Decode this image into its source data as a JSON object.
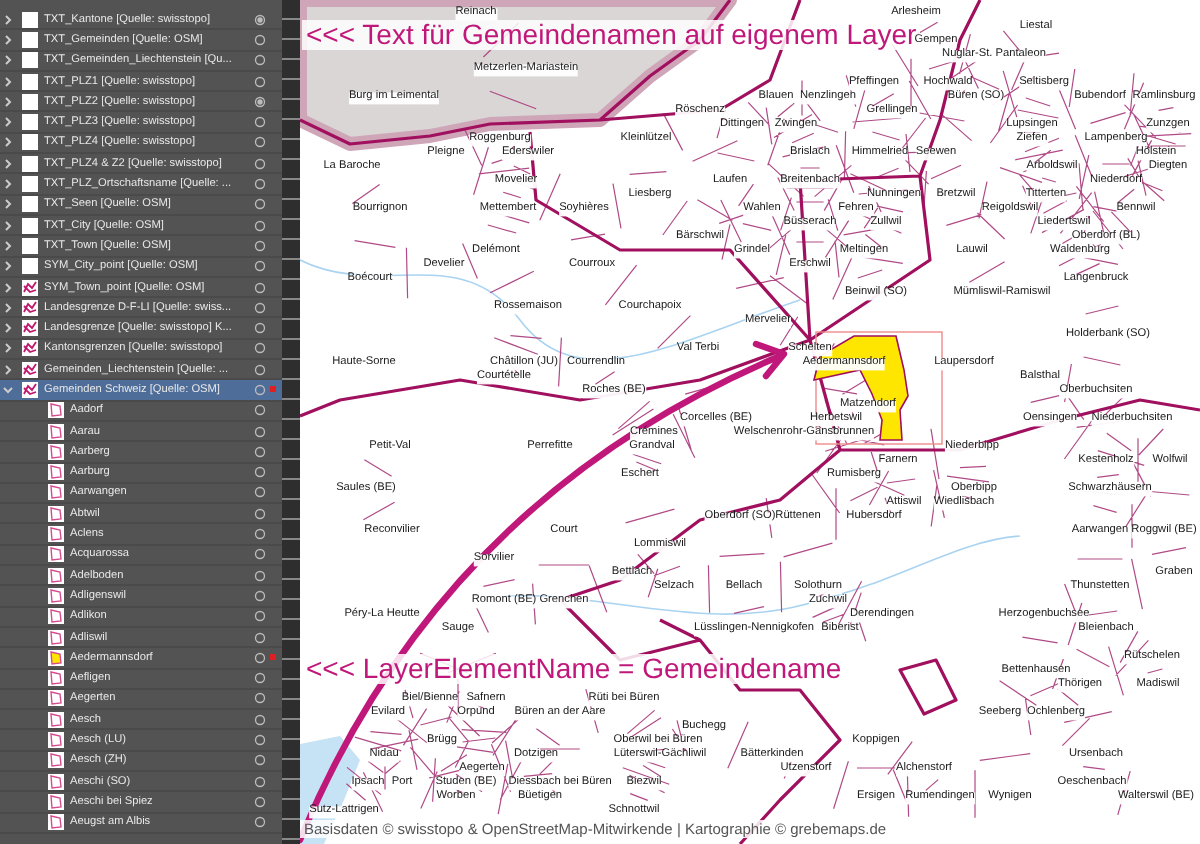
{
  "layers_panel": {
    "layers": [
      {
        "name": "TXT_Kantone [Quelle: swisstopo]",
        "kind": "blank",
        "targeted": true,
        "expanded": false,
        "selected": false
      },
      {
        "name": "TXT_Gemeinden [Quelle: OSM]",
        "kind": "blank",
        "targeted": false,
        "expanded": false,
        "selected": false
      },
      {
        "name": "TXT_Gemeinden_Liechtenstein [Qu...",
        "kind": "blank",
        "targeted": false,
        "expanded": false,
        "selected": false
      },
      {
        "name": "TXT_PLZ1 [Quelle: swisstopo]",
        "kind": "blank",
        "targeted": false,
        "expanded": false,
        "selected": false
      },
      {
        "name": "TXT_PLZ2 [Quelle: swisstopo]",
        "kind": "blank",
        "targeted": true,
        "expanded": false,
        "selected": false
      },
      {
        "name": "TXT_PLZ3 [Quelle: swisstopo]",
        "kind": "blank",
        "targeted": false,
        "expanded": false,
        "selected": false
      },
      {
        "name": "TXT_PLZ4 [Quelle: swisstopo]",
        "kind": "blank",
        "targeted": false,
        "expanded": false,
        "selected": false
      },
      {
        "name": "TXT_PLZ4 & Z2 [Quelle: swisstopo]",
        "kind": "blank",
        "targeted": false,
        "expanded": false,
        "selected": false
      },
      {
        "name": "TXT_PLZ_Ortschaftsname [Quelle: ...",
        "kind": "blank",
        "targeted": false,
        "expanded": false,
        "selected": false
      },
      {
        "name": "TXT_Seen [Quelle: OSM]",
        "kind": "blank",
        "targeted": false,
        "expanded": false,
        "selected": false
      },
      {
        "name": "TXT_City [Quelle: OSM]",
        "kind": "blank",
        "targeted": false,
        "expanded": false,
        "selected": false
      },
      {
        "name": "TXT_Town [Quelle: OSM]",
        "kind": "blank",
        "targeted": false,
        "expanded": false,
        "selected": false
      },
      {
        "name": "SYM_City_point [Quelle: OSM]",
        "kind": "blank",
        "targeted": false,
        "expanded": false,
        "selected": false
      },
      {
        "name": "SYM_Town_point [Quelle: OSM]",
        "kind": "drawing",
        "targeted": false,
        "expanded": false,
        "selected": false
      },
      {
        "name": "Landesgrenze D-F-LI [Quelle: swiss...",
        "kind": "drawing",
        "targeted": false,
        "expanded": false,
        "selected": false
      },
      {
        "name": "Landesgrenze [Quelle: swisstopo] K...",
        "kind": "drawing",
        "targeted": false,
        "expanded": false,
        "selected": false
      },
      {
        "name": "Kantonsgrenzen [Quelle: swisstopo]",
        "kind": "drawing",
        "targeted": false,
        "expanded": false,
        "selected": false
      },
      {
        "name": "Gemeinden_Liechtenstein [Quelle: ...",
        "kind": "drawing",
        "targeted": false,
        "expanded": false,
        "selected": false
      },
      {
        "name": "Gemeinden Schweiz [Quelle: OSM]",
        "kind": "drawing",
        "targeted": false,
        "expanded": true,
        "selected": true,
        "children": [
          {
            "name": "Aadorf",
            "selected": false
          },
          {
            "name": "Aarau",
            "selected": false
          },
          {
            "name": "Aarberg",
            "selected": false
          },
          {
            "name": "Aarburg",
            "selected": false
          },
          {
            "name": "Aarwangen",
            "selected": false
          },
          {
            "name": "Abtwil",
            "selected": false
          },
          {
            "name": "Aclens",
            "selected": false
          },
          {
            "name": "Acquarossa",
            "selected": false
          },
          {
            "name": "Adelboden",
            "selected": false
          },
          {
            "name": "Adligenswil",
            "selected": false
          },
          {
            "name": "Adlikon",
            "selected": false
          },
          {
            "name": "Adliswil",
            "selected": false
          },
          {
            "name": "Aedermannsdorf",
            "selected": true
          },
          {
            "name": "Aefligen",
            "selected": false
          },
          {
            "name": "Aegerten",
            "selected": false
          },
          {
            "name": "Aesch",
            "selected": false
          },
          {
            "name": "Aesch (LU)",
            "selected": false
          },
          {
            "name": "Aesch (ZH)",
            "selected": false
          },
          {
            "name": "Aeschi (SO)",
            "selected": false
          },
          {
            "name": "Aeschi bei Spiez",
            "selected": false
          },
          {
            "name": "Aeugst am Albis",
            "selected": false
          }
        ]
      }
    ]
  },
  "map": {
    "labels": [
      "Reinach",
      "Arlesheim",
      "Liestal",
      "Gempen",
      "Nuglar-St. Pantaleon",
      "Metzerlen-Mariastein",
      "Pfeffingen",
      "Hochwald",
      "Seltisberg",
      "Burg im Leimental",
      "Blauen",
      "Nenzlingen",
      "Büren (SO)",
      "Bubendorf",
      "Ramlinsburg",
      "Röschenz",
      "Grellingen",
      "Dittingen",
      "Zwingen",
      "Lupsingen",
      "Zunzgen",
      "Roggenburg",
      "Kleinlützel",
      "Ziefen",
      "Lampenberg",
      "Pleigne",
      "Ederswiler",
      "Brislach",
      "Himmelried",
      "Seewen",
      "Hölstein",
      "La Baroche",
      "Arboldswil",
      "Diegten",
      "Movelier",
      "Laufen",
      "Breitenbach",
      "Niederdorf",
      "Liesberg",
      "Nunningen",
      "Bretzwil",
      "Titterten",
      "Bourrignon",
      "Mettembert",
      "Soyhières",
      "Wahlen",
      "Fehren",
      "Reigoldswil",
      "Bennwil",
      "Büsserach",
      "Zullwil",
      "Liedertswil",
      "Bärschwil",
      "Oberdorf (BL)",
      "Delémont",
      "Grindel",
      "Meltingen",
      "Lauwil",
      "Waldenburg",
      "Develier",
      "Courroux",
      "Erschwil",
      "Boécourt",
      "Langenbruck",
      "Beinwil (SO)",
      "Mümliswil-Ramiswil",
      "Rossemaison",
      "Courchapoix",
      "Mervelier",
      "Holderbank (SO)",
      "Val Terbi",
      "Schelten",
      "Haute-Sorne",
      "Châtillon (JU)",
      "Courrendlin",
      "Aedermannsdorf",
      "Laupersdorf",
      "Courtételle",
      "Balsthal",
      "Roches (BE)",
      "Oberbuchsiten",
      "Matzendorf",
      "Corcelles (BE)",
      "Herbetswil",
      "Oensingen",
      "Niederbuchsiten",
      "Crémines",
      "Welschenrohr-Gänsbrunnen",
      "Petit-Val",
      "Perrefitte",
      "Grandval",
      "Niederbipp",
      "Farnern",
      "Kestenholz",
      "Wolfwil",
      "Eschert",
      "Rumisberg",
      "Saules (BE)",
      "Oberbipp",
      "Schwarzhäusern",
      "Attiswil",
      "Wiedlisbach",
      "Oberdorf (SO)",
      "Rüttenen",
      "Hubersdorf",
      "Reconvilier",
      "Court",
      "Aarwangen",
      "Roggwil (BE)",
      "Lommiswil",
      "Sorvilier",
      "Bettlach",
      "Graben",
      "Selzach",
      "Bellach",
      "Solothurn",
      "Thunstetten",
      "Romont (BE)",
      "Grenchen",
      "Zuchwil",
      "Péry-La Heutte",
      "Derendingen",
      "Herzogenbuchsee",
      "Sauge",
      "Lüsslingen-Nennigkofen",
      "Biberist",
      "Bleienbach",
      "Rütschelen",
      "Bettenhausen",
      "Thörigen",
      "Madiswil",
      "Biel/Bienne",
      "Safnern",
      "Rüti bei Büren",
      "Evilard",
      "Orpund",
      "Büren an der Aare",
      "Seeberg",
      "Ochlenberg",
      "Buchegg",
      "Brügg",
      "Oberwil bei Büren",
      "Koppigen",
      "Nidau",
      "Dotzigen",
      "Lüterswil-Gächliwil",
      "Bätterkinden",
      "Ursenbach",
      "Aegerten",
      "Utzenstorf",
      "Alchenstorf",
      "Ipsach",
      "Port",
      "Studen (BE)",
      "Diessbach bei Büren",
      "Biezwil",
      "Oeschenbach",
      "Worben",
      "Büetigen",
      "Ersigen",
      "Rumendingen",
      "Wynigen",
      "Walterswil (BE)",
      "Sutz-Lattrigen",
      "Schnottwil"
    ],
    "selection": {
      "visible": true
    },
    "annotations": [
      "<<< Text für Gemeindenamen auf eigenem Layer",
      "<<< LayerElementName = Gemeindename"
    ],
    "credit": "Basisdaten © swisstopo & OpenStreetMap-Mitwirkende | Kartographie © grebemaps.de"
  }
}
